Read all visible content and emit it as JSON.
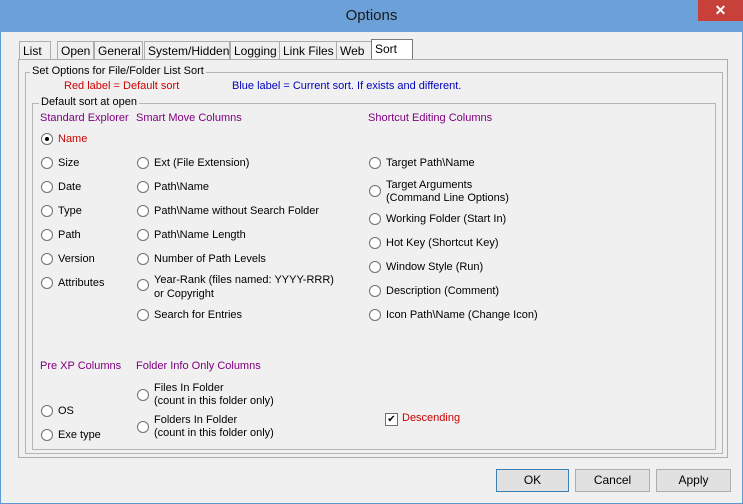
{
  "window": {
    "title": "Options",
    "close_glyph": "✕"
  },
  "tabs": [
    {
      "label": "List"
    },
    {
      "label": "Open"
    },
    {
      "label": "General"
    },
    {
      "label": "System/Hidden"
    },
    {
      "label": "Logging"
    },
    {
      "label": "Link Files"
    },
    {
      "label": "Web"
    },
    {
      "label": "Sort"
    }
  ],
  "sort": {
    "outer_group": "Set Options for File/Folder List Sort",
    "red_note": "Red label = Default sort",
    "blue_note": "Blue label = Current sort. If exists and different.",
    "inner_group": "Default sort at open",
    "headers": {
      "standard": "Standard Explorer",
      "smart": "Smart Move Columns",
      "shortcut": "Shortcut Editing Columns",
      "prexp": "Pre XP Columns",
      "folderinfo": "Folder Info Only Columns"
    },
    "standard": [
      "Name",
      "Size",
      "Date",
      "Type",
      "Path",
      "Version",
      "Attributes"
    ],
    "smart": [
      "Ext (File Extension)",
      "Path\\Name",
      "Path\\Name without Search Folder",
      "Path\\Name Length",
      "Number of Path Levels",
      "Year-Rank (files named: YYYY-RRR)",
      "or Copyright",
      "Search for Entries"
    ],
    "shortcut": [
      "Target Path\\Name",
      "Target Arguments",
      "(Command Line Options)",
      "Working Folder (Start In)",
      "Hot Key (Shortcut Key)",
      "Window Style (Run)",
      "Description (Comment)",
      "Icon Path\\Name (Change Icon)"
    ],
    "prexp": [
      "OS",
      "Exe type"
    ],
    "folderinfo": [
      "Files In Folder",
      "(count in this folder only)",
      "Folders In Folder",
      "(count in this folder only)"
    ],
    "descending_label": "Descending",
    "descending_checked": true,
    "selected": "Name"
  },
  "buttons": {
    "ok": "OK",
    "cancel": "Cancel",
    "apply": "Apply"
  }
}
